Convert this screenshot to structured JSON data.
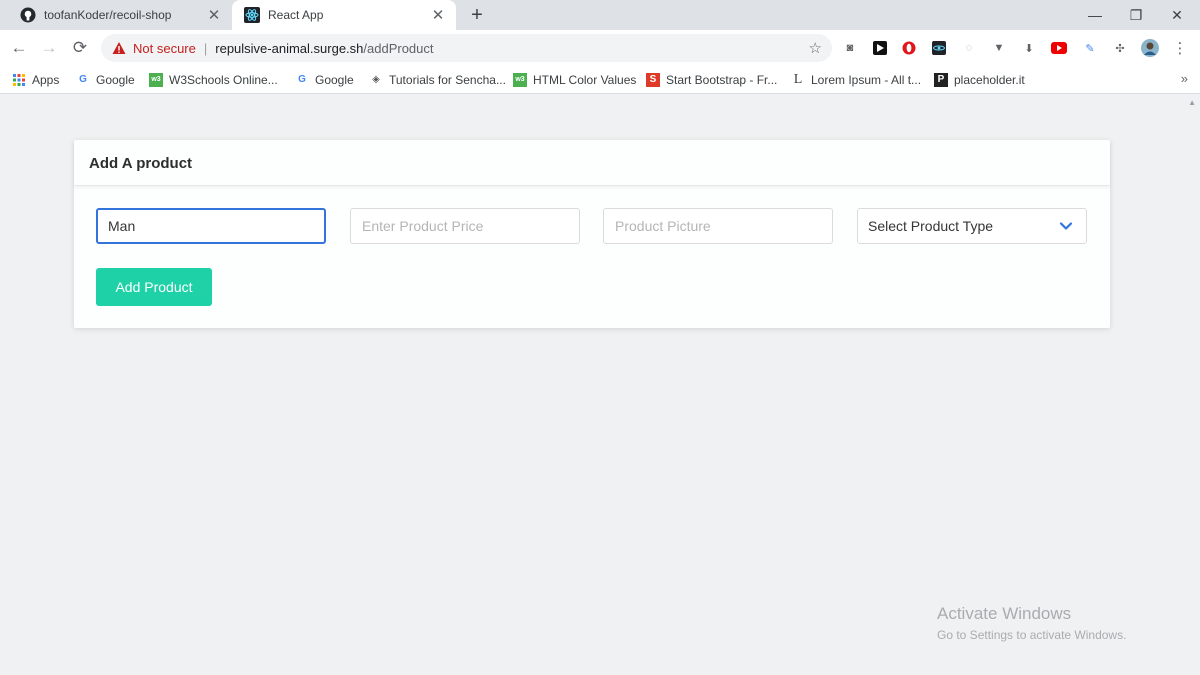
{
  "browser": {
    "tabs": [
      {
        "title": "toofanKoder/recoil-shop",
        "icon": "github-icon",
        "active": false
      },
      {
        "title": "React App",
        "icon": "react-icon",
        "active": true
      }
    ],
    "new_tab_label": "+",
    "address": {
      "security_label": "Not secure",
      "separator": "|",
      "host": "repulsive-animal.surge.sh",
      "path": "/addProduct"
    },
    "bookmarks": [
      {
        "label": "Apps",
        "icon": "apps-grid-icon"
      },
      {
        "label": "Google",
        "icon": "google-icon"
      },
      {
        "label": "W3Schools Online...",
        "icon": "w3schools-icon"
      },
      {
        "label": "Google",
        "icon": "google-icon"
      },
      {
        "label": "Tutorials for Sencha...",
        "icon": "sencha-icon"
      },
      {
        "label": "HTML Color Values",
        "icon": "w3schools-icon"
      },
      {
        "label": "Start Bootstrap - Fr...",
        "icon": "startbootstrap-icon"
      },
      {
        "label": "Lorem Ipsum - All t...",
        "icon": "lorem-ipsum-icon"
      },
      {
        "label": "placeholder.it",
        "icon": "placeholder-icon"
      }
    ],
    "bookmarks_overflow": "»"
  },
  "card": {
    "title": "Add A product",
    "name_input": {
      "value": "Man",
      "placeholder": ""
    },
    "price_input": {
      "value": "",
      "placeholder": "Enter Product Price"
    },
    "picture_input": {
      "value": "",
      "placeholder": "Product Picture"
    },
    "type_select": {
      "selected": "Select Product Type"
    },
    "submit_label": "Add Product"
  },
  "watermark": {
    "line1": "Activate Windows",
    "line2": "Go to Settings to activate Windows."
  },
  "colors": {
    "accent_button": "#1fd1a7",
    "focus_border": "#3273dc",
    "not_secure": "#c5221f"
  }
}
